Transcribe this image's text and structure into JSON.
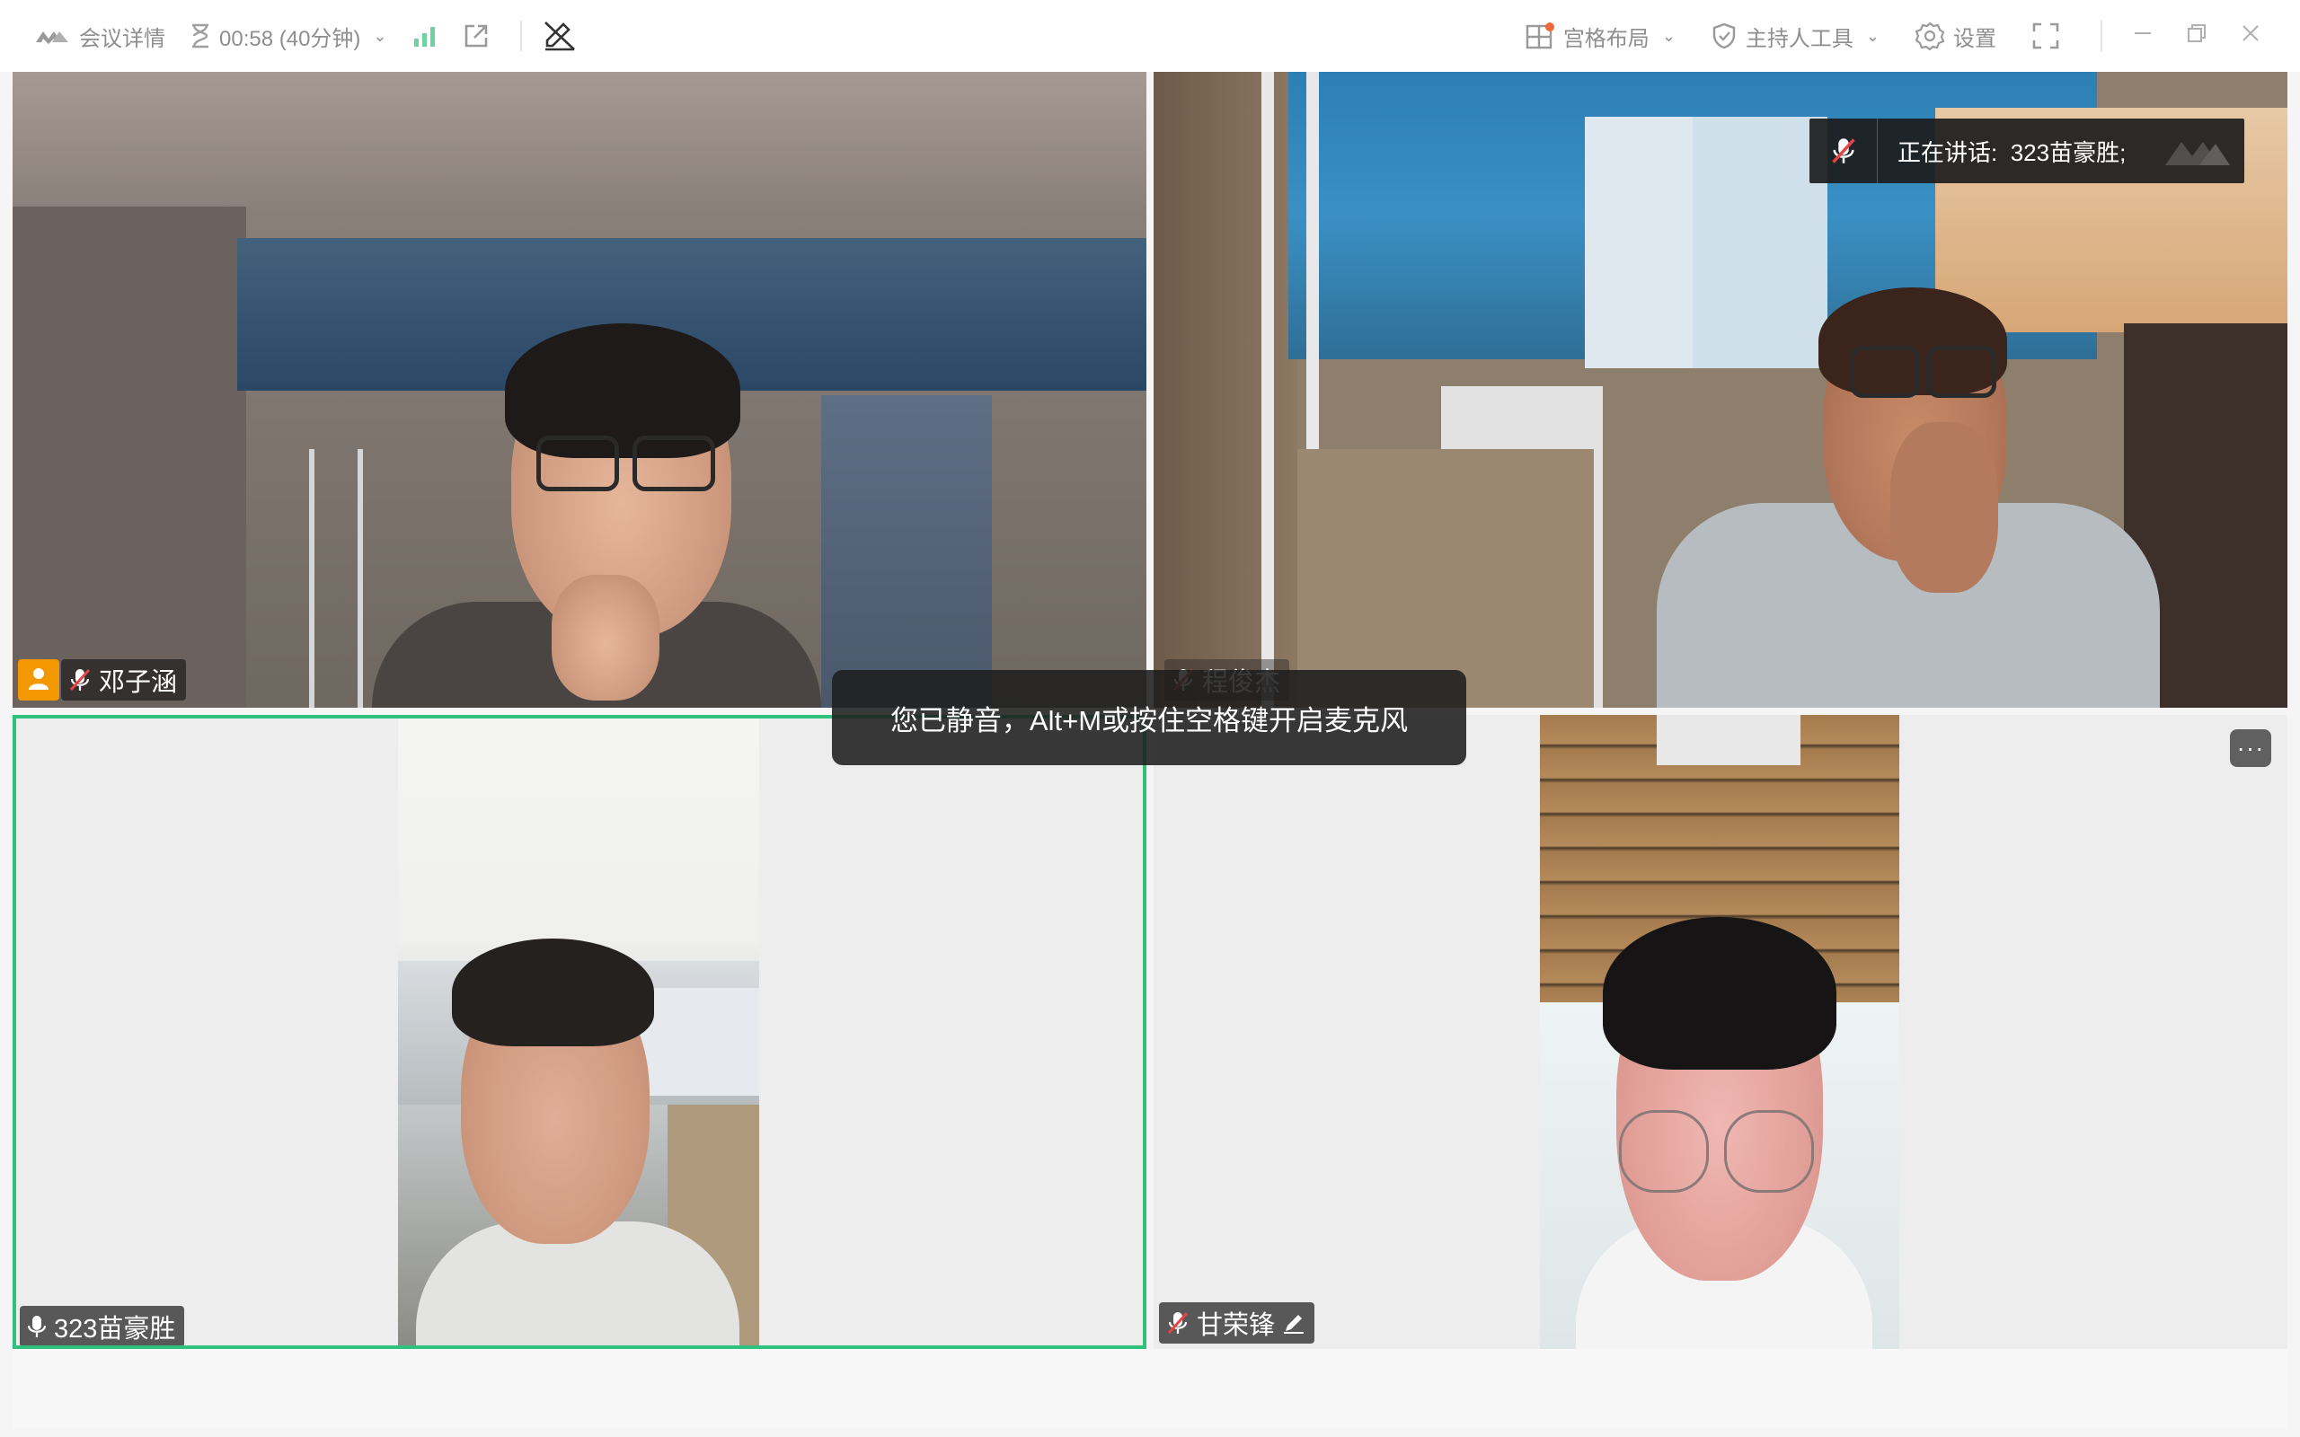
{
  "toolbar": {
    "meeting_details": "会议详情",
    "timer": "00:58 (40分钟)",
    "grid_layout": "宫格布局",
    "host_tools": "主持人工具",
    "settings": "设置"
  },
  "speaking": {
    "label": "正在讲话:",
    "name": "323苗豪胜;"
  },
  "toast": {
    "text": "您已静音，Alt+M或按住空格键开启麦克风"
  },
  "participants": [
    {
      "name": "邓子涵",
      "muted": true,
      "host": true
    },
    {
      "name": "程俊杰",
      "muted": true,
      "host": false
    },
    {
      "name": "323苗豪胜",
      "muted": false,
      "host": false,
      "active_speaker": true
    },
    {
      "name": "甘荣锋",
      "muted": true,
      "host": false,
      "annotate": true
    }
  ],
  "colors": {
    "active_border": "#2ec27e",
    "host_badge": "#f39800",
    "signal_bar": "#3dbd7d"
  },
  "more_button": "···"
}
